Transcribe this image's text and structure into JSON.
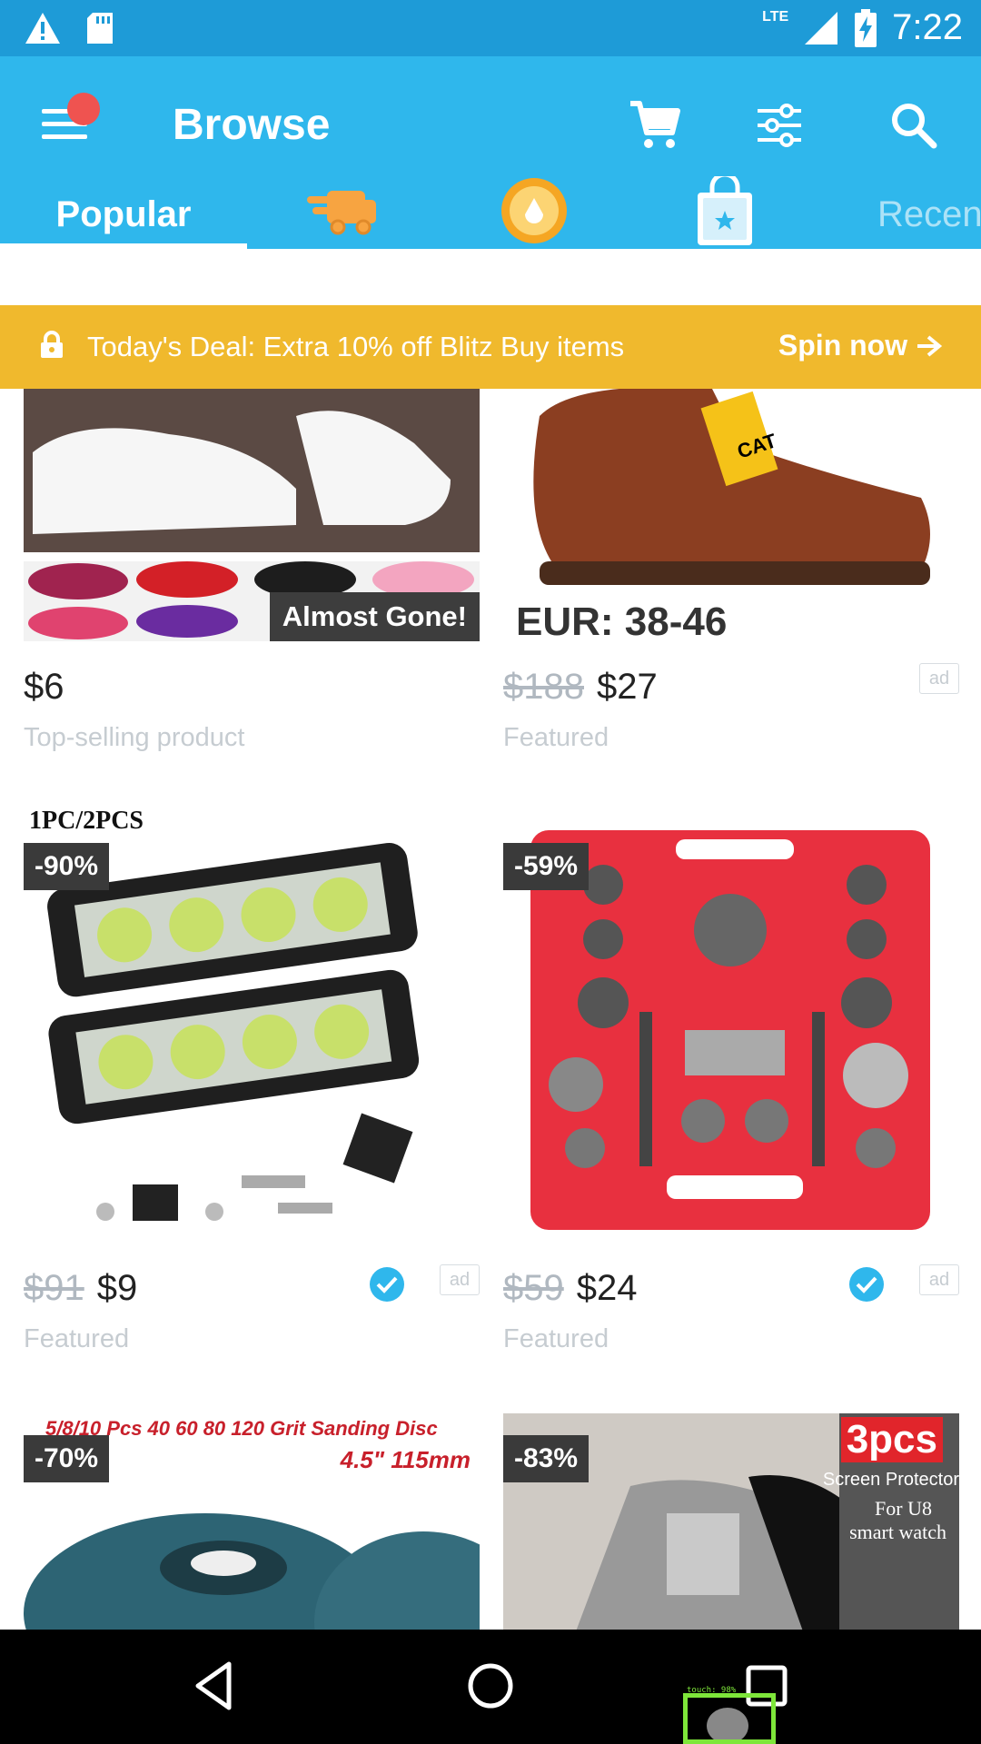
{
  "status_bar": {
    "time": "7:22",
    "network": "LTE"
  },
  "app_bar": {
    "title": "Browse"
  },
  "tabs": {
    "popular": "Popular",
    "recent": "Recen"
  },
  "deal_banner": {
    "text": "Today's Deal: Extra 10% off Blitz Buy items",
    "action": "Spin now"
  },
  "products": [
    {
      "price": "$6",
      "old_price": "",
      "label": "Top-selling product",
      "badge": "Almost Gone!",
      "image_text": ""
    },
    {
      "price": "$27",
      "old_price": "$188",
      "label": "Featured",
      "badge": "",
      "ad": "ad",
      "image_text": "EUR: 38-46"
    },
    {
      "price": "$9",
      "old_price": "$91",
      "label": "Featured",
      "discount": "-90%",
      "ad": "ad",
      "image_text": "1PC/2PCS"
    },
    {
      "price": "$24",
      "old_price": "$59",
      "label": "Featured",
      "discount": "-59%",
      "ad": "ad"
    },
    {
      "discount": "-70%",
      "image_text_1": "5/8/10 Pcs 40 60 80 120 Grit Sanding Disc",
      "image_text_2": "4.5\" 115mm"
    },
    {
      "discount": "-83%",
      "image_text_1": "3pcs",
      "image_text_2": "Screen Protector",
      "image_text_3": "For U8",
      "image_text_4": "smart watch"
    }
  ],
  "touch_overlay": {
    "text": "touch: 98%"
  },
  "colors": {
    "primary": "#2fb7ec",
    "status": "#1e9bd7",
    "deal": "#f0b92d",
    "notification": "#ef5350"
  }
}
